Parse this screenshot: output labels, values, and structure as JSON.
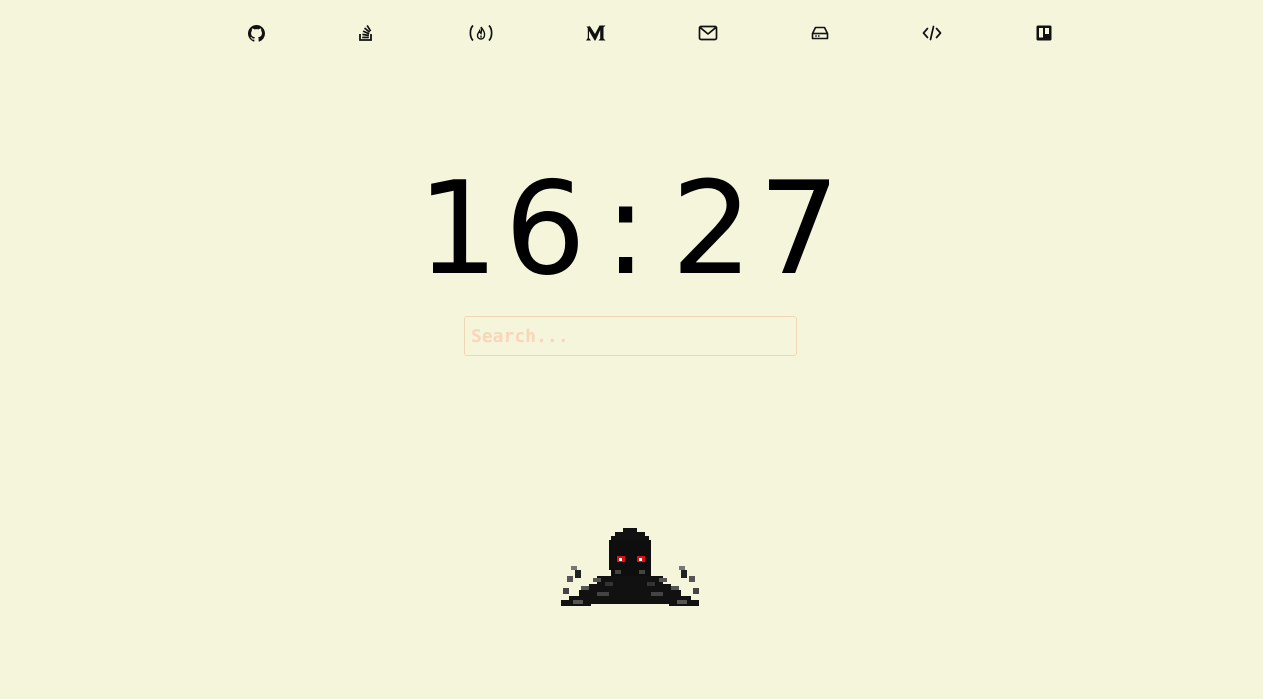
{
  "nav": {
    "links": [
      {
        "icon": "github-icon"
      },
      {
        "icon": "stackoverflow-icon"
      },
      {
        "icon": "freecodecamp-icon"
      },
      {
        "icon": "medium-icon"
      },
      {
        "icon": "mail-icon"
      },
      {
        "icon": "drive-icon"
      },
      {
        "icon": "code-icon"
      },
      {
        "icon": "trello-icon"
      }
    ]
  },
  "clock": {
    "hours": "16",
    "separator": ":",
    "minutes": "27"
  },
  "search": {
    "placeholder": "Search..."
  },
  "mascot": {
    "icon": "pixel-octopus-icon",
    "eye_color": "#e01010"
  },
  "colors": {
    "background": "#f5f5dc",
    "text": "#000000",
    "search_border": "#f0d8b4",
    "placeholder": "#fbd5b8"
  }
}
